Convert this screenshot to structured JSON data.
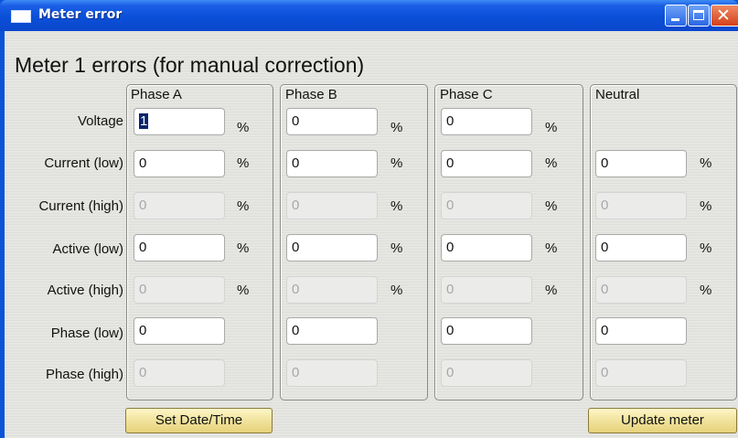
{
  "window": {
    "title": "Meter error"
  },
  "heading": "Meter 1 errors (for manual correction)",
  "groups": [
    "Phase A",
    "Phase B",
    "Phase C",
    "Neutral"
  ],
  "row_labels": [
    "Voltage",
    "Current (low)",
    "Current (high)",
    "Active (low)",
    "Active (high)",
    "Phase (low)",
    "Phase (high)"
  ],
  "percent_symbol": "%",
  "values": {
    "phase_a": {
      "voltage": "1",
      "current_low": "0",
      "current_high": "0",
      "active_low": "0",
      "active_high": "0",
      "phase_low": "0",
      "phase_high": "0"
    },
    "phase_b": {
      "voltage": "0",
      "current_low": "0",
      "current_high": "0",
      "active_low": "0",
      "active_high": "0",
      "phase_low": "0",
      "phase_high": "0"
    },
    "phase_c": {
      "voltage": "0",
      "current_low": "0",
      "current_high": "0",
      "active_low": "0",
      "active_high": "0",
      "phase_low": "0",
      "phase_high": "0"
    },
    "neutral": {
      "current_low": "0",
      "current_high": "0",
      "active_low": "0",
      "active_high": "0",
      "phase_low": "0",
      "phase_high": "0"
    }
  },
  "buttons": {
    "set_date_time": "Set Date/Time",
    "update_meter": "Update meter"
  }
}
